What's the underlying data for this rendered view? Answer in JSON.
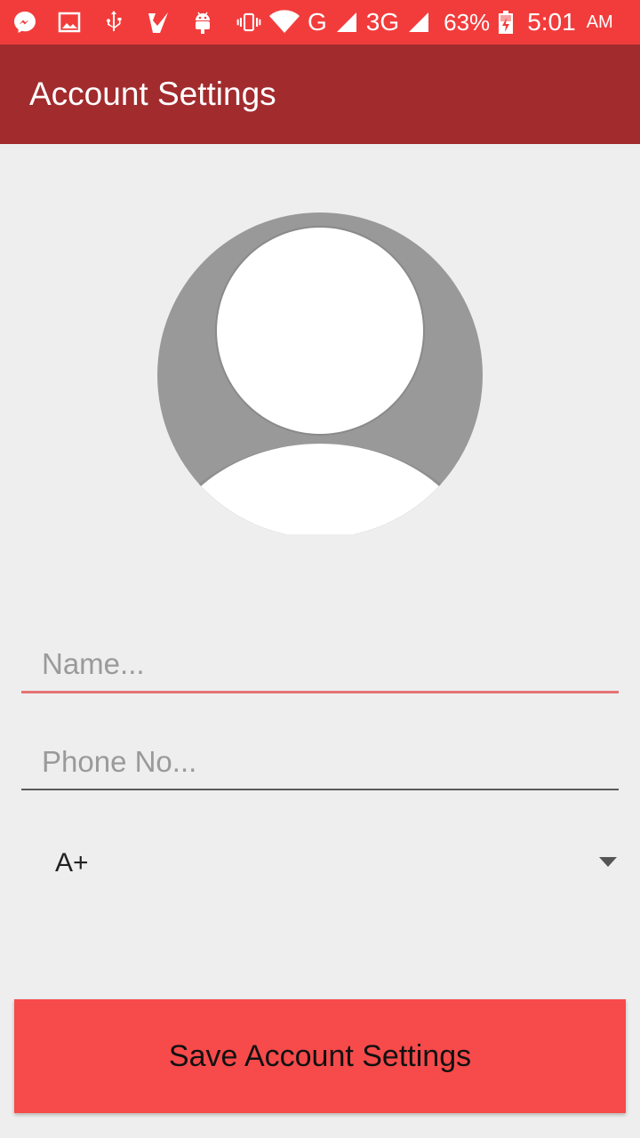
{
  "status_bar": {
    "network_g": "G",
    "network_3g": "3G",
    "battery_percent": "63%",
    "time": "5:01",
    "ampm": "AM",
    "icons": [
      "messenger-icon",
      "image-icon",
      "usb-icon",
      "check-app-icon",
      "android-icon",
      "vibrate-icon",
      "wifi-icon",
      "signal-icon",
      "battery-charging-icon"
    ]
  },
  "app_bar": {
    "title": "Account Settings"
  },
  "form": {
    "name_placeholder": "Name...",
    "name_value": "",
    "phone_placeholder": "Phone No...",
    "phone_value": "",
    "blood_group_selected": "A+"
  },
  "actions": {
    "save_label": "Save Account Settings"
  },
  "colors": {
    "status_bar": "#f23c3c",
    "app_bar": "#a22b2e",
    "save_button": "#f74a4a",
    "background": "#eeeeee",
    "active_underline": "#e57373"
  }
}
